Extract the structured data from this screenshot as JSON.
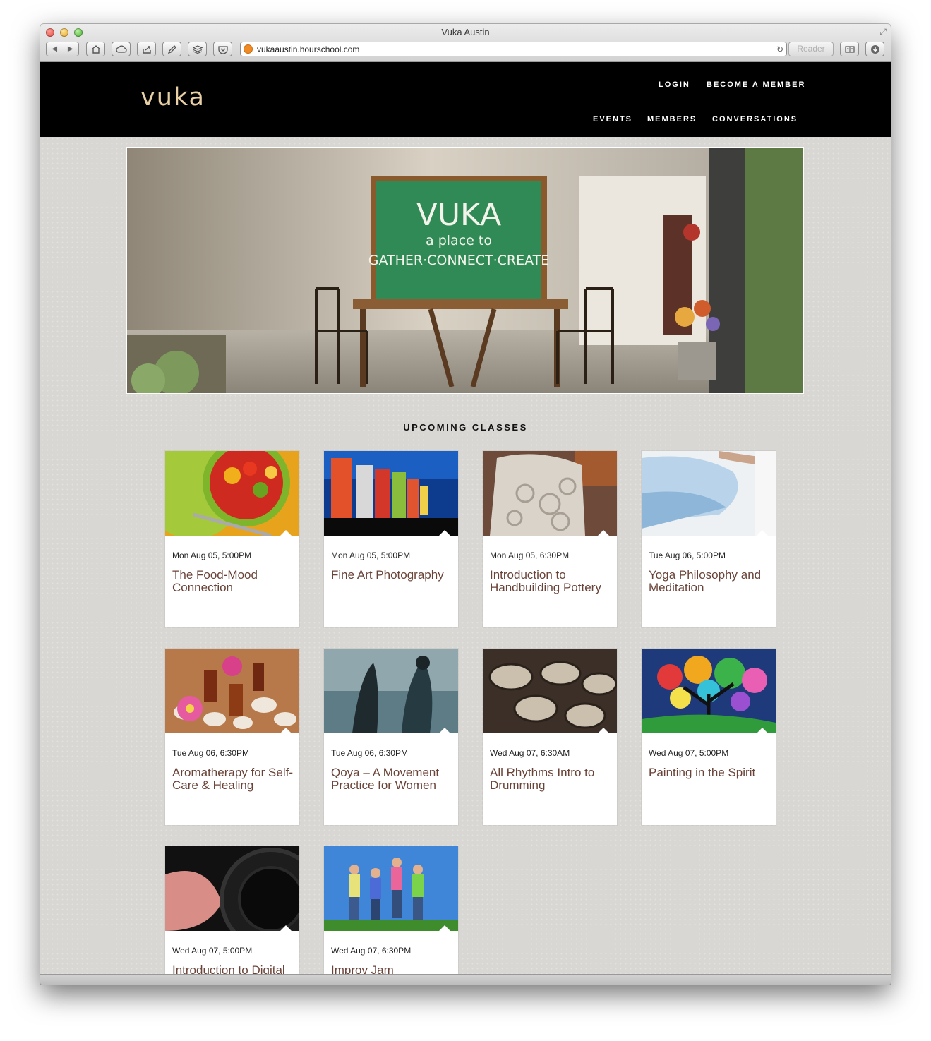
{
  "browser": {
    "window_title": "Vuka Austin",
    "url": "vukaaustin.hourschool.com",
    "reader_label": "Reader"
  },
  "site": {
    "logo": "vuka",
    "nav_top": [
      "LOGIN",
      "BECOME A MEMBER"
    ],
    "nav_main": [
      "EVENTS",
      "MEMBERS",
      "CONVERSATIONS"
    ]
  },
  "hero": {
    "chalk_title": "VUKA",
    "chalk_line2": "a place to",
    "chalk_line3": "GATHER·CONNECT·CREATE"
  },
  "section_title": "UPCOMING CLASSES",
  "classes": [
    {
      "date": "Mon Aug 05, 5:00PM",
      "title": "The Food-Mood Connection",
      "image": "fruit-salad-photo"
    },
    {
      "date": "Mon Aug 05, 5:00PM",
      "title": "Fine Art Photography",
      "image": "colorful-reflections-photo"
    },
    {
      "date": "Mon Aug 05, 6:30PM",
      "title": "Introduction to Handbuilding Pottery",
      "image": "clay-pottery-photo"
    },
    {
      "date": "Tue Aug 06, 5:00PM",
      "title": "Yoga Philosophy and Meditation",
      "image": "yoga-pose-photo"
    },
    {
      "date": "Tue Aug 06, 6:30PM",
      "title": "Aromatherapy for Self-Care & Healing",
      "image": "essential-oils-photo"
    },
    {
      "date": "Tue Aug 06, 6:30PM",
      "title": "Qoya – A Movement Practice for Women",
      "image": "dancing-women-photo"
    },
    {
      "date": "Wed Aug 07, 6:30AM",
      "title": "All Rhythms Intro to Drumming",
      "image": "drums-photo"
    },
    {
      "date": "Wed Aug 07, 5:00PM",
      "title": "Painting in the Spirit",
      "image": "painted-tree-photo"
    },
    {
      "date": "Wed Aug 07, 5:00PM",
      "title": "Introduction to Digital",
      "image": "camera-lens-photo"
    },
    {
      "date": "Wed Aug 07, 6:30PM",
      "title": "Improv Jam",
      "image": "jumping-friends-photo"
    }
  ],
  "colors": {
    "header_bg": "#000000",
    "logo": "#e9cfa4",
    "class_title": "#6a4338",
    "page_bg": "#d9d7d3"
  }
}
